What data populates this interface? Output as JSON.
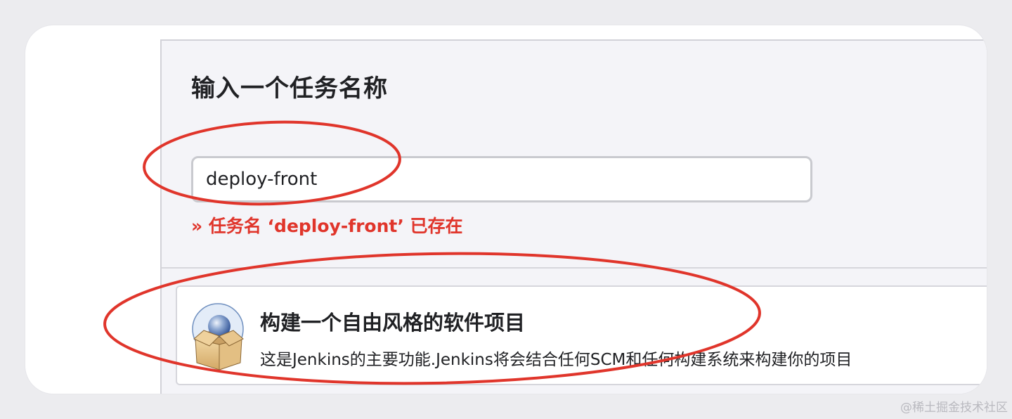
{
  "form": {
    "heading": "输入一个任务名称",
    "name_value": "deploy-front",
    "error_message": "» 任务名 ‘deploy-front’ 已存在"
  },
  "project_type": {
    "title": "构建一个自由风格的软件项目",
    "description": "这是Jenkins的主要功能.Jenkins将会结合任何SCM和任何构建系统来构建你的项目",
    "icon": "package-box-icon"
  },
  "annotations": {
    "color": "#e0352b"
  },
  "watermark": "@稀土掘金技术社区",
  "colors": {
    "error": "#e0352b",
    "panel_bg": "#f4f4f8"
  }
}
